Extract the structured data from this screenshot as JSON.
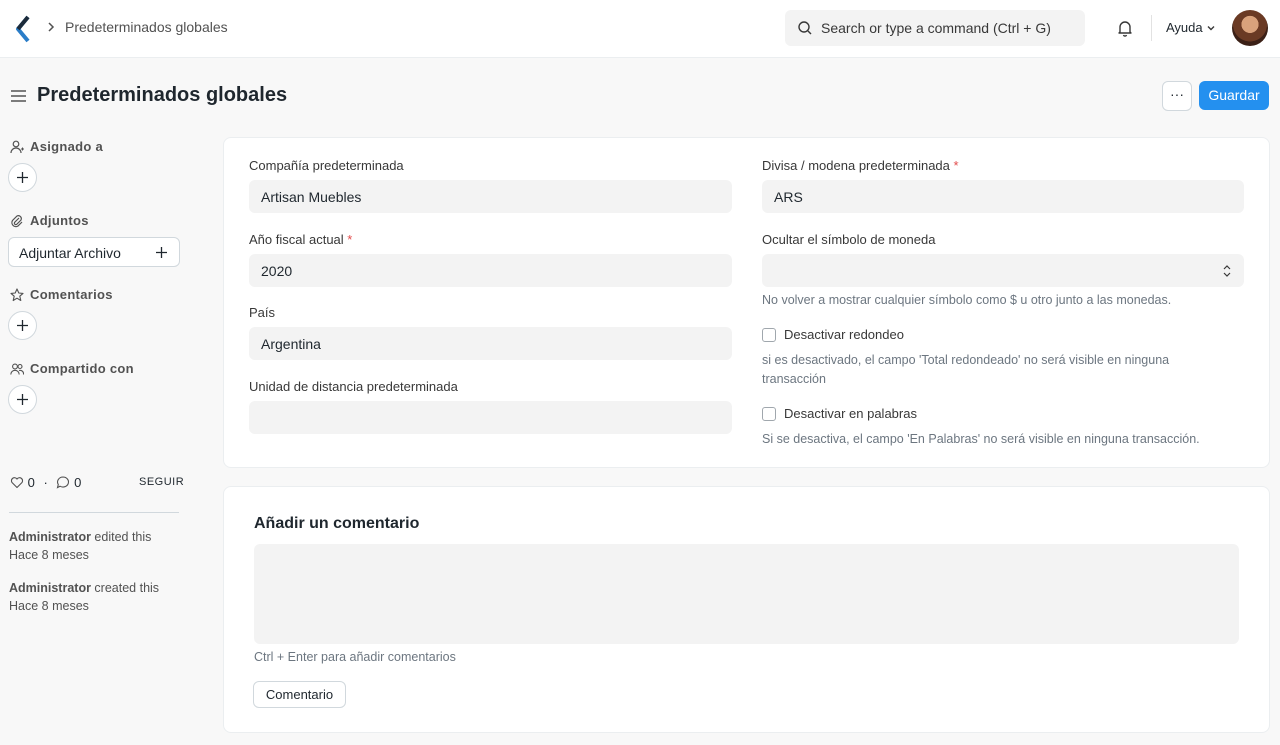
{
  "navbar": {
    "breadcrumb": "Predeterminados globales",
    "search_placeholder": "Search or type a command (Ctrl + G)",
    "help_label": "Ayuda"
  },
  "page": {
    "title": "Predeterminados globales",
    "more_label": "···",
    "save_label": "Guardar"
  },
  "sidebar": {
    "assigned_label": "Asignado a",
    "attachments_label": "Adjuntos",
    "attach_button": "Adjuntar Archivo",
    "comments_label": "Comentarios",
    "shared_label": "Compartido con",
    "likes": "0",
    "comments_count": "0",
    "dot": "·",
    "follow_label": "SEGUIR",
    "activity": [
      {
        "user": "Administrator",
        "action": " edited this",
        "time": "Hace 8 meses"
      },
      {
        "user": "Administrator",
        "action": " created this",
        "time": "Hace 8 meses"
      }
    ]
  },
  "form": {
    "company_label": "Compañía predeterminada",
    "company_value": "Artisan Muebles",
    "fiscal_year_label": "Año fiscal actual",
    "fiscal_year_value": "2020",
    "country_label": "País",
    "country_value": "Argentina",
    "distance_unit_label": "Unidad de distancia predeterminada",
    "distance_unit_value": "",
    "currency_label": "Divisa / modena predeterminada",
    "currency_value": "ARS",
    "hide_symbol_label": "Ocultar el símbolo de moneda",
    "hide_symbol_value": "",
    "hide_symbol_help": "No volver a mostrar cualquier símbolo como $ u otro junto a las monedas.",
    "disable_rounding_label": "Desactivar redondeo",
    "disable_rounding_checked": false,
    "disable_rounding_help": "si es desactivado, el campo 'Total redondeado' no será visible en ninguna transacción",
    "disable_words_label": "Desactivar en palabras",
    "disable_words_checked": false,
    "disable_words_help": "Si se desactiva, el campo 'En Palabras' no será visible en ninguna transacción.",
    "required_mark": "*"
  },
  "comment": {
    "title": "Añadir un comentario",
    "hint": "Ctrl + Enter para añadir comentarios",
    "button": "Comentario"
  },
  "colors": {
    "primary": "#2490ef",
    "required": "#e24c4c"
  }
}
